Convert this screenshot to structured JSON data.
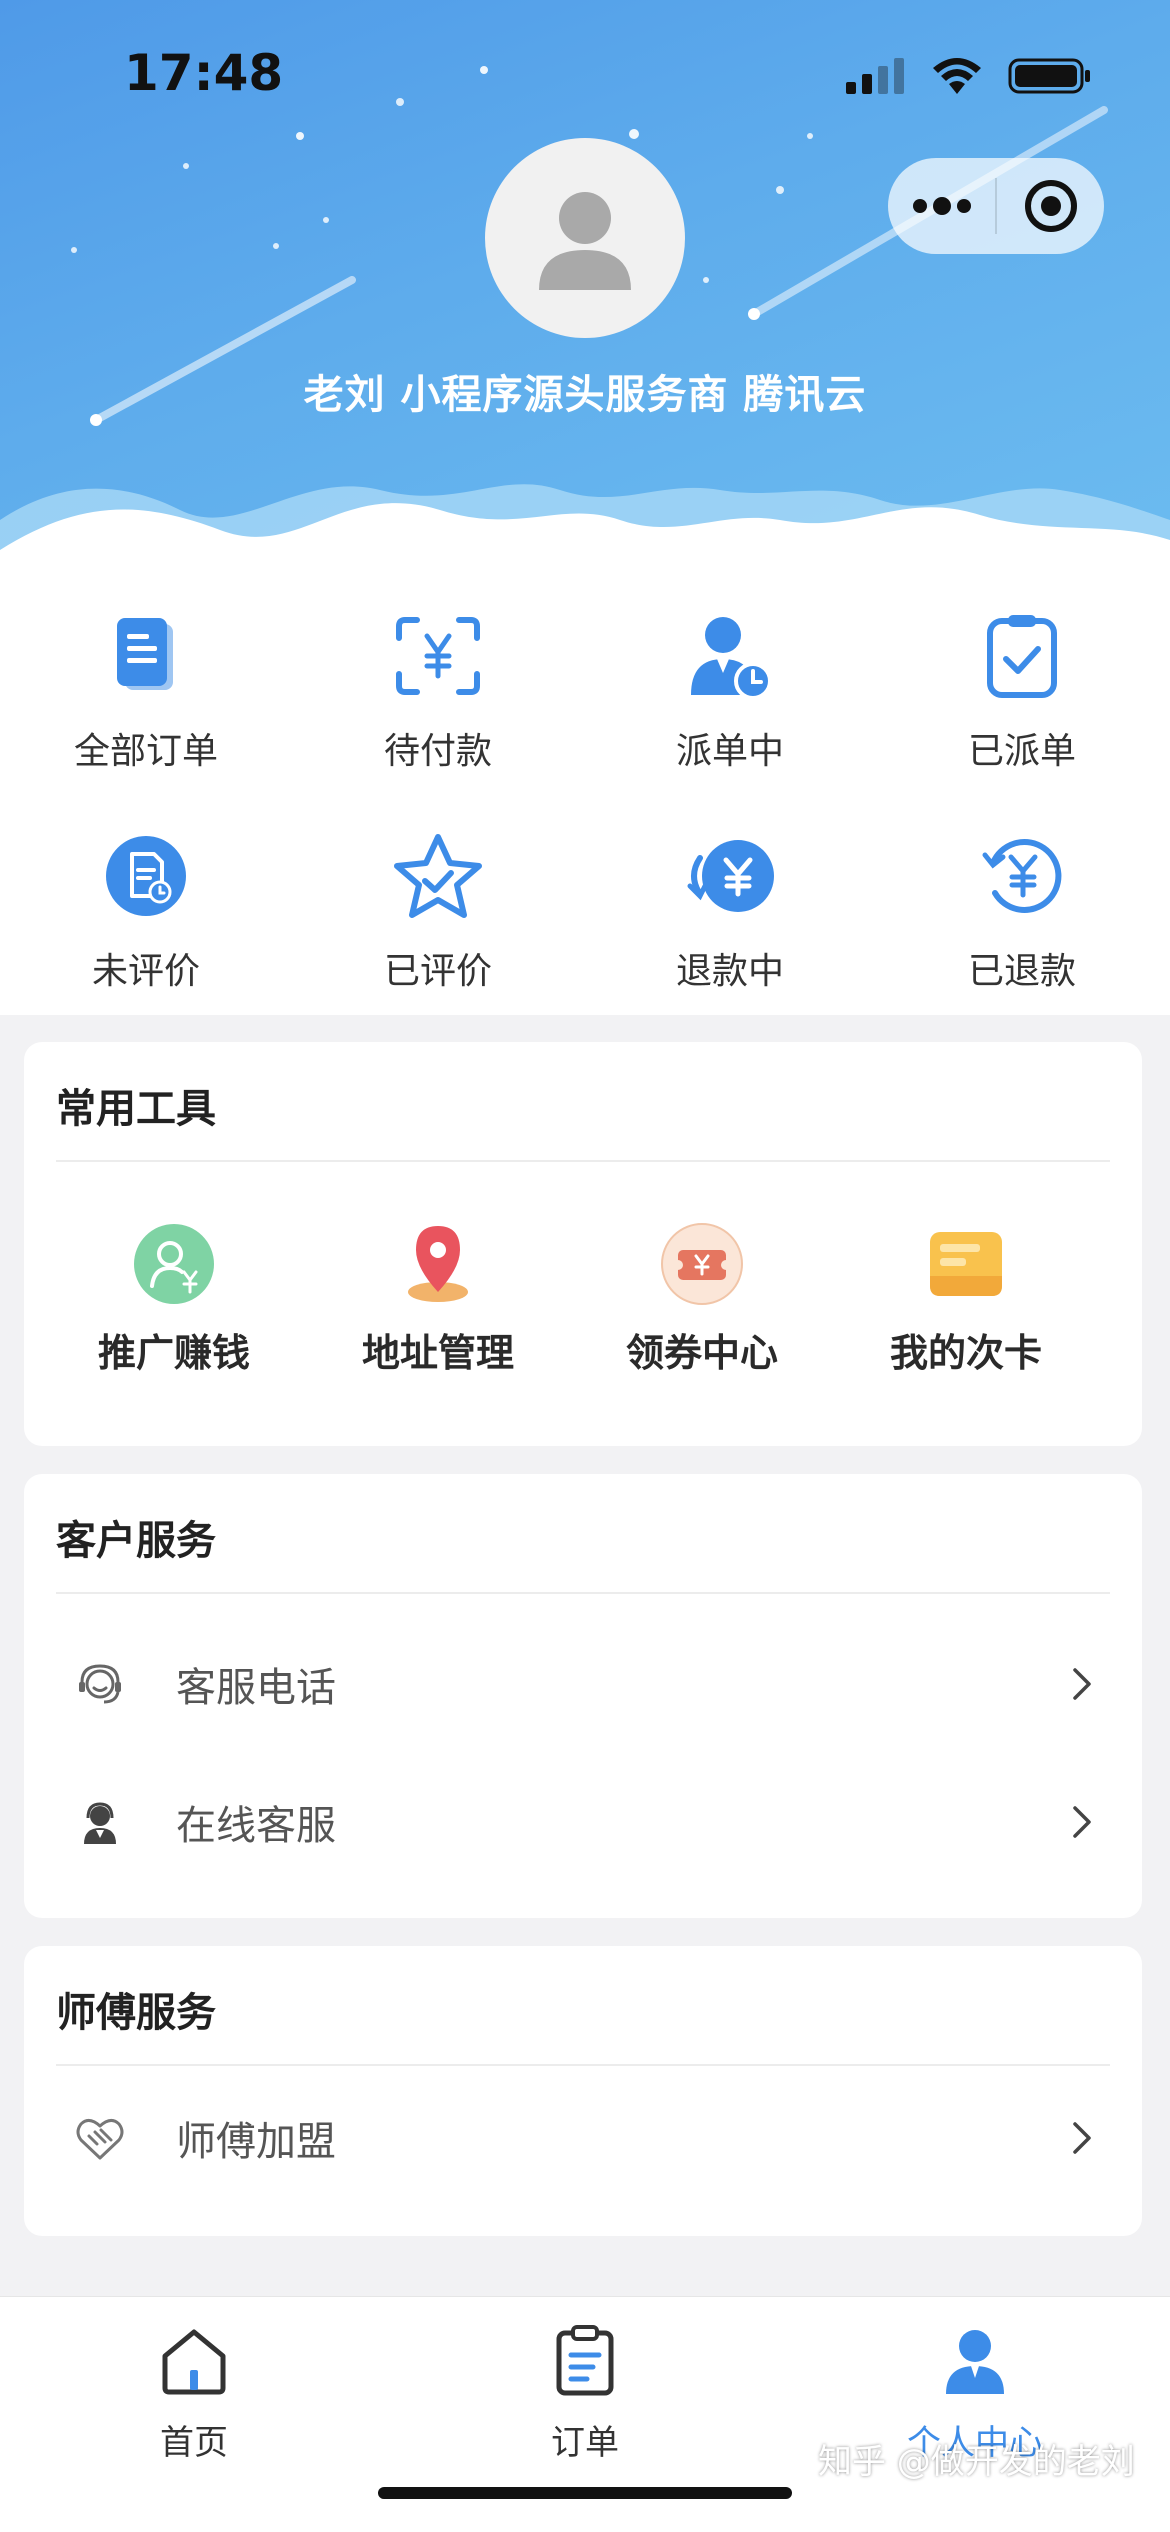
{
  "status_bar": {
    "time": "17:48"
  },
  "header": {
    "user_name": "老刘 小程序源头服务商 腾讯云"
  },
  "orders": [
    {
      "label": "全部订单",
      "icon": "document-icon"
    },
    {
      "label": "待付款",
      "icon": "scan-yen-icon"
    },
    {
      "label": "派单中",
      "icon": "person-clock-icon"
    },
    {
      "label": "已派单",
      "icon": "clipboard-check-icon"
    },
    {
      "label": "未评价",
      "icon": "note-circle-icon"
    },
    {
      "label": "已评价",
      "icon": "star-check-icon"
    },
    {
      "label": "退款中",
      "icon": "refund-yen-icon"
    },
    {
      "label": "已退款",
      "icon": "refunded-yen-icon"
    }
  ],
  "tools": {
    "title": "常用工具",
    "items": [
      {
        "label": "推广赚钱",
        "icon": "user-yen-icon"
      },
      {
        "label": "地址管理",
        "icon": "location-pin-icon"
      },
      {
        "label": "领券中心",
        "icon": "coupon-icon"
      },
      {
        "label": "我的次卡",
        "icon": "card-icon"
      }
    ]
  },
  "customer_service": {
    "title": "客户服务",
    "items": [
      {
        "label": "客服电话",
        "icon": "headset-icon"
      },
      {
        "label": "在线客服",
        "icon": "agent-icon"
      }
    ]
  },
  "master_service": {
    "title": "师傅服务",
    "items": [
      {
        "label": "师傅加盟",
        "icon": "handshake-icon"
      }
    ]
  },
  "tabbar": {
    "items": [
      {
        "label": "首页",
        "icon": "home-icon"
      },
      {
        "label": "订单",
        "icon": "clipboard-list-icon"
      },
      {
        "label": "个人中心",
        "icon": "person-icon"
      }
    ],
    "active_color": "#3d8ce8"
  },
  "watermark": "知乎 @做开发的老刘",
  "colors": {
    "header_blue": "#5aa8ec",
    "icon_blue": "#3d8ce8"
  }
}
